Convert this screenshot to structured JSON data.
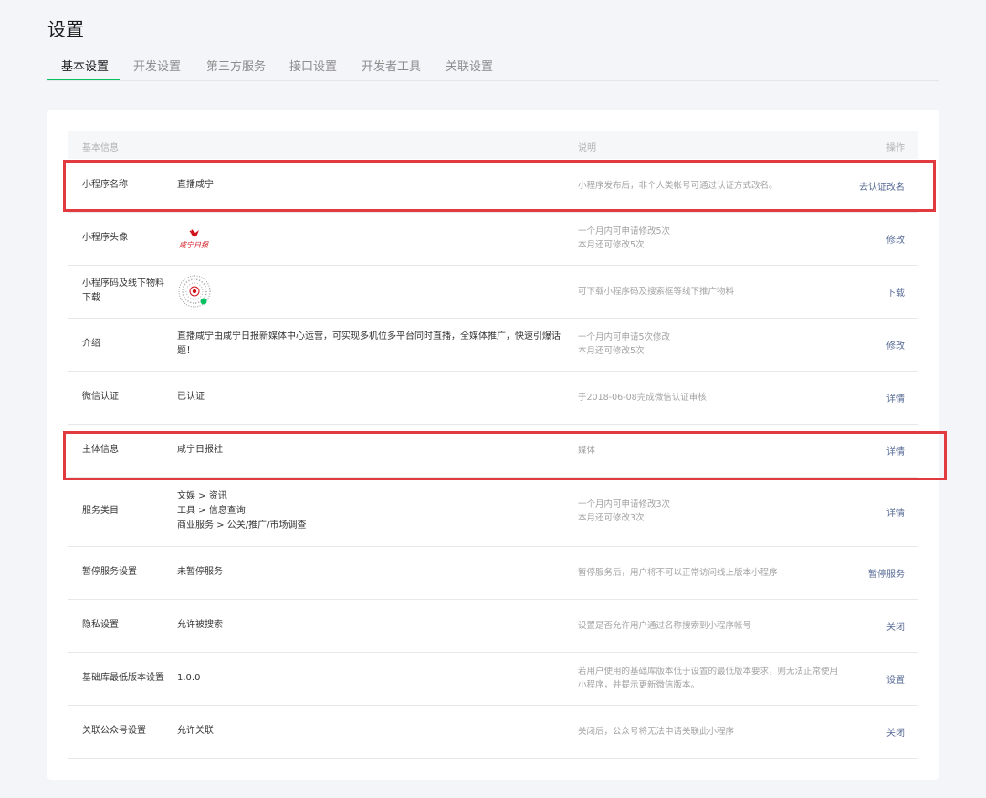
{
  "page": {
    "title": "设置"
  },
  "tabs": [
    "基本设置",
    "开发设置",
    "第三方服务",
    "接口设置",
    "开发者工具",
    "关联设置"
  ],
  "table": {
    "headers": {
      "info": "基本信息",
      "desc": "说明",
      "op": "操作"
    },
    "rows": [
      {
        "label": "小程序名称",
        "value": "直播咸宁",
        "desc": "小程序发布后，非个人类帐号可通过认证方式改名。",
        "op": "去认证改名"
      },
      {
        "label": "小程序头像",
        "value_icon": "xianning-daily-logo",
        "avatar_caption": "咸宁日报",
        "desc": [
          "一个月内可申请修改5次",
          "本月还可修改5次"
        ],
        "op": "修改"
      },
      {
        "label": "小程序码及线下物料下载",
        "value_icon": "mini-program-code",
        "desc": "可下载小程序码及搜索框等线下推广物料",
        "op": "下载"
      },
      {
        "label": "介绍",
        "value": "直播咸宁由咸宁日报新媒体中心运营，可实现多机位多平台同时直播，全媒体推广，快速引爆话题！",
        "desc": [
          "一个月内可申请5次修改",
          "本月还可修改5次"
        ],
        "op": "修改"
      },
      {
        "label": "微信认证",
        "value": "已认证",
        "desc": "于2018-06-08完成微信认证审核",
        "op": "详情"
      },
      {
        "label": "主体信息",
        "value": "咸宁日报社",
        "desc": "媒体",
        "op": "详情"
      },
      {
        "label": "服务类目",
        "value": [
          "文娱 > 资讯",
          "工具 > 信息查询",
          "商业服务 > 公关/推广/市场调查"
        ],
        "desc": [
          "一个月内可申请修改3次",
          "本月还可修改3次"
        ],
        "op": "详情"
      },
      {
        "label": "暂停服务设置",
        "value": "未暂停服务",
        "desc": "暂停服务后，用户将不可以正常访问线上版本小程序",
        "op": "暂停服务"
      },
      {
        "label": "隐私设置",
        "value": "允许被搜索",
        "desc": "设置是否允许用户通过名称搜索到小程序帐号",
        "op": "关闭"
      },
      {
        "label": "基础库最低版本设置",
        "value": "1.0.0",
        "desc": "若用户使用的基础库版本低于设置的最低版本要求，则无法正常使用小程序，并提示更新微信版本。",
        "op": "设置"
      },
      {
        "label": "关联公众号设置",
        "value": "允许关联",
        "desc": "关闭后，公众号将无法申请关联此小程序",
        "op": "关闭"
      }
    ]
  },
  "colors": {
    "accent": "#07c160",
    "link": "#576b95",
    "highlight": "#e13a3f",
    "logo_red": "#d0121b"
  }
}
